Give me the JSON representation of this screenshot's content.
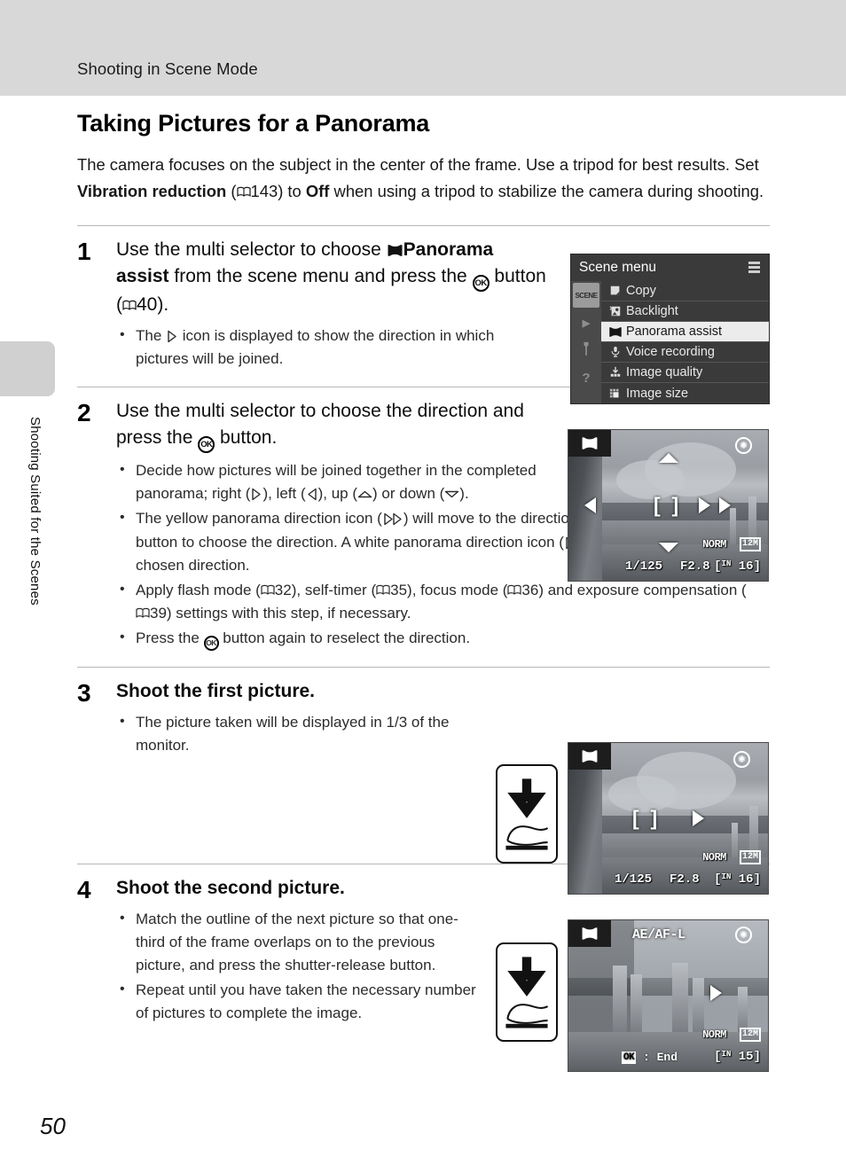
{
  "header": {
    "running_title": "Shooting in Scene Mode"
  },
  "side_tab": {
    "label": "Shooting Suited for the Scenes"
  },
  "page_number": "50",
  "title": "Taking Pictures for a Panorama",
  "intro": {
    "part1": "The camera focuses on the subject in the center of the frame. Use a tripod for best results. Set ",
    "bold1": "Vibration reduction",
    "part2": " (",
    "ref1": "143",
    "part3": ") to ",
    "bold2": "Off",
    "part4": " when using a tripod to stabilize the camera during shooting."
  },
  "steps": [
    {
      "number": "1",
      "head_a": "Use the multi selector to choose ",
      "head_bold_a": "Panorama assist",
      "head_b": " from the scene menu and press the ",
      "head_c": " button (",
      "head_ref": "40",
      "head_d": ").",
      "bullets": [
        {
          "a": "The ",
          "b": " icon is displayed to show the direction in which pictures will be joined."
        }
      ]
    },
    {
      "number": "2",
      "head_a": "Use the multi selector to choose the direction and press the ",
      "head_c": " button.",
      "bullets": [
        {
          "text_a": "Decide how pictures will be joined together in the completed panorama; right (",
          "text_b": "), left (",
          "text_c": "), up (",
          "text_d": ") or down (",
          "text_e": ")."
        },
        {
          "text_a": "The yellow panorama direction icon (",
          "text_b": ") will move to the direction pressed, so press the ",
          "text_c": " button to choose the direction. A white panorama direction icon (",
          "text_d": ") will be displayed in the chosen direction."
        },
        {
          "text_a": "Apply flash mode (",
          "ref1": "32",
          "text_b": "), self-timer (",
          "ref2": "35",
          "text_c": "), focus mode (",
          "ref3": "36",
          "text_d": ") and exposure compensation (",
          "ref4": "39",
          "text_e": ") settings with this step, if necessary."
        },
        {
          "text_a": "Press the ",
          "text_b": " button again to reselect the direction."
        }
      ]
    },
    {
      "number": "3",
      "head": "Shoot the first picture.",
      "bullets": [
        "The picture taken will be displayed in 1/3 of the monitor."
      ]
    },
    {
      "number": "4",
      "head": "Shoot the second picture.",
      "bullets": [
        "Match the outline of the next picture so that one-third of the frame overlaps on to the previous picture, and press the shutter-release button.",
        "Repeat until you have taken the necessary number of pictures to complete the image."
      ]
    }
  ],
  "scene_menu": {
    "title": "Scene menu",
    "side_icons": [
      {
        "name": "scene-tab",
        "label": "SCENE",
        "selected": true
      },
      {
        "name": "playback-tab",
        "label": "▶",
        "selected": false
      },
      {
        "name": "setup-tab",
        "label": "ᴧ",
        "selected": false
      },
      {
        "name": "help-tab",
        "label": "?",
        "selected": false
      }
    ],
    "items": [
      {
        "label": "Copy",
        "icon": "copy-icon",
        "selected": false
      },
      {
        "label": "Backlight",
        "icon": "backlight-icon",
        "selected": false
      },
      {
        "label": "Panorama assist",
        "icon": "panorama-assist-icon",
        "selected": true
      },
      {
        "label": "Voice recording",
        "icon": "microphone-icon",
        "selected": false
      },
      {
        "label": "Image quality",
        "icon": "image-quality-icon",
        "selected": false
      },
      {
        "label": "Image size",
        "icon": "image-size-icon",
        "selected": false
      }
    ]
  },
  "lcd_step2": {
    "shutter_speed": "1/125",
    "aperture": "F2.8",
    "quality": "NORM",
    "image_size": "12M",
    "memory": "IN",
    "frames_remaining": "16"
  },
  "lcd_step3": {
    "shutter_speed": "1/125",
    "aperture": "F2.8",
    "quality": "NORM",
    "image_size": "12M",
    "memory": "IN",
    "frames_remaining": "16"
  },
  "lcd_step4": {
    "lock_indicator": "AE/AF-L",
    "ok_hint_key": "OK",
    "ok_hint_text": ": End",
    "quality": "NORM",
    "image_size": "12M",
    "memory": "IN",
    "frames_remaining": "15"
  },
  "colors": {
    "header_band": "#d8d8d8",
    "rule": "#b7b7b7",
    "menu_bg": "#3a3a3a",
    "menu_selected_bg": "#ececec",
    "text": "#111111"
  }
}
